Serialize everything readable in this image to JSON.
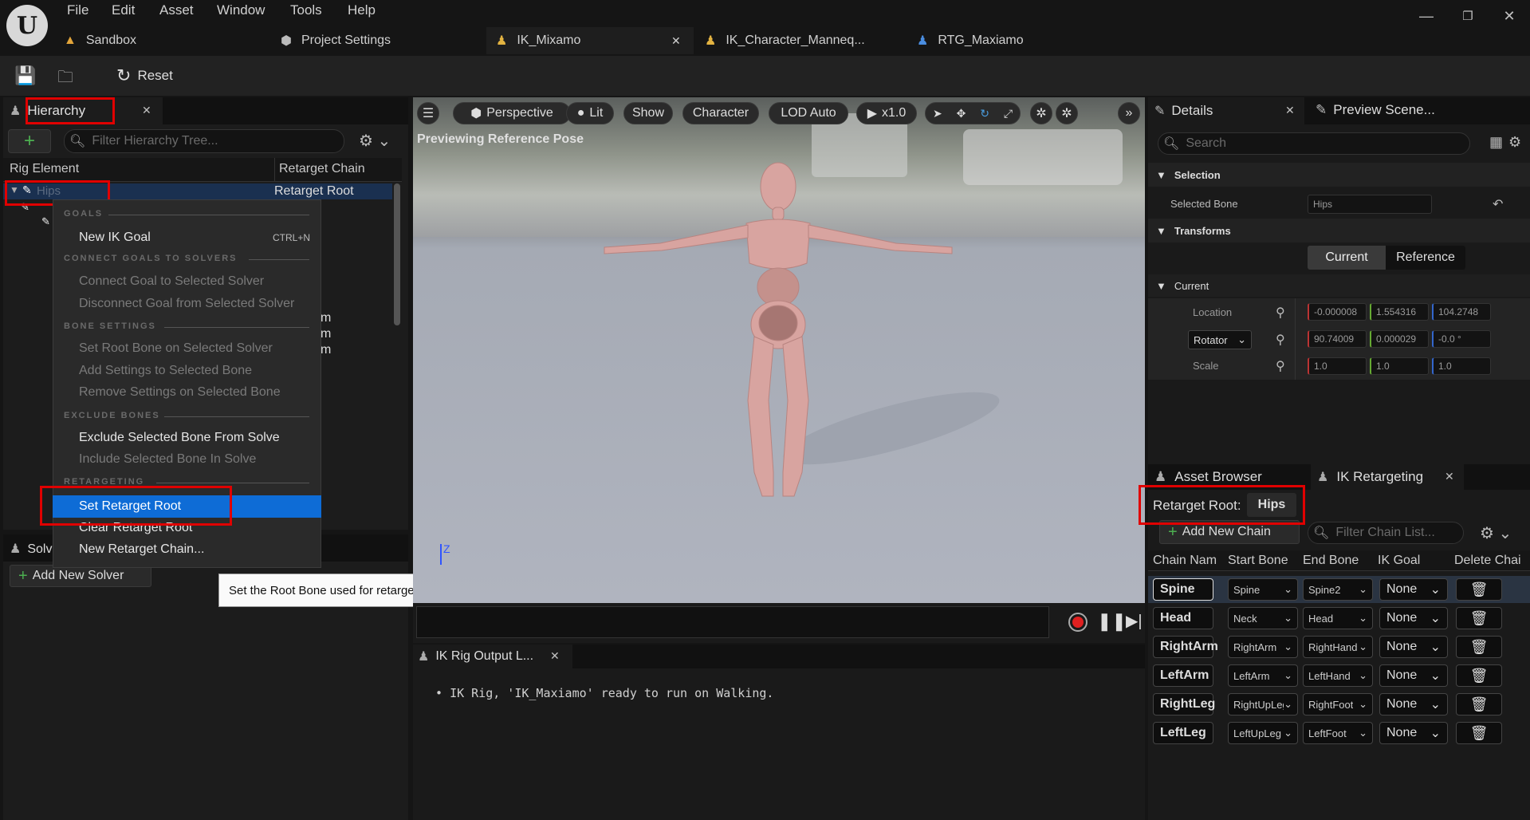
{
  "menu": [
    "File",
    "Edit",
    "Asset",
    "Window",
    "Tools",
    "Help"
  ],
  "tabs": [
    {
      "label": "Sandbox"
    },
    {
      "label": "Project Settings"
    },
    {
      "label": "IK_Mixamo"
    },
    {
      "label": "IK_Character_Manneq..."
    },
    {
      "label": "RTG_Maxiamo"
    }
  ],
  "toolbar": {
    "reset_label": "Reset"
  },
  "hierarchy": {
    "tab_label": "Hierarchy",
    "filter_placeholder": "Filter Hierarchy Tree...",
    "col_rig_element": "Rig Element",
    "col_retarget_chain": "Retarget Chain",
    "root_row_name": "Hips",
    "root_row_chain": "Retarget Root",
    "partial_m": "m"
  },
  "context_menu": {
    "sections": {
      "goals": "GOALS",
      "connect": "CONNECT GOALS TO SOLVERS",
      "bone": "BONE SETTINGS",
      "exclude": "EXCLUDE BONES",
      "retarget": "RETARGETING"
    },
    "new_ik_goal": "New IK Goal",
    "new_ik_goal_shortcut": "CTRL+N",
    "connect_goal": "Connect Goal to Selected Solver",
    "disconnect_goal": "Disconnect Goal from Selected Solver",
    "set_root_bone": "Set Root Bone on Selected Solver",
    "add_settings": "Add Settings to Selected Bone",
    "remove_settings": "Remove Settings on Selected Bone",
    "exclude_bone": "Exclude Selected Bone From Solve",
    "include_bone": "Include Selected Bone In Solve",
    "set_retarget_root": "Set Retarget Root",
    "clear_retarget_root": "Clear Retarget Root",
    "new_retarget_chain": "New Retarget Chain..."
  },
  "tooltip": "Set the Root Bone used for retargeting. Usually 'Pelvis'.",
  "solver": {
    "tab_partial": "Solv",
    "add_solver": "Add New Solver"
  },
  "viewport": {
    "perspective": "Perspective",
    "lit": "Lit",
    "show": "Show",
    "character": "Character",
    "lod": "LOD Auto",
    "speed": "x1.0",
    "previewing": "Previewing Reference Pose",
    "axis_z": "Z"
  },
  "output": {
    "tab_label": "IK Rig Output L...",
    "line": "IK Rig, 'IK_Maxiamo' ready to run on Walking."
  },
  "details": {
    "tab_label": "Details",
    "preview_tab": "Preview Scene...",
    "search_placeholder": "Search",
    "selection": "Selection",
    "selected_bone_label": "Selected Bone",
    "selected_bone_value": "Hips",
    "transforms": "Transforms",
    "btn_current": "Current",
    "btn_reference": "Reference",
    "current": "Current",
    "location_label": "Location",
    "location": [
      "-0.000008",
      "1.554316",
      "104.2748"
    ],
    "rotator_label": "Rotator",
    "rotator": [
      "90.74009",
      "0.000029",
      "-0.0 °"
    ],
    "scale_label": "Scale",
    "scale": [
      "1.0",
      "1.0",
      "1.0"
    ]
  },
  "retarget": {
    "asset_browser_tab": "Asset Browser",
    "ik_retargeting_tab": "IK Retargeting",
    "root_label": "Retarget Root:",
    "root_value": "Hips",
    "add_chain": "Add New Chain",
    "filter_placeholder": "Filter Chain List...",
    "headers": [
      "Chain Nam",
      "Start Bone",
      "End Bone",
      "IK Goal",
      "Delete Chai"
    ],
    "rows": [
      {
        "name": "Spine",
        "start": "Spine",
        "end": "Spine2",
        "goal": "None"
      },
      {
        "name": "Head",
        "start": "Neck",
        "end": "Head",
        "goal": "None"
      },
      {
        "name": "RightArm",
        "start": "RightArm",
        "end": "RightHand",
        "goal": "None"
      },
      {
        "name": "LeftArm",
        "start": "LeftArm",
        "end": "LeftHand",
        "goal": "None"
      },
      {
        "name": "RightLeg",
        "start": "RightUpLeg",
        "end": "RightFoot",
        "goal": "None"
      },
      {
        "name": "LeftLeg",
        "start": "LeftUpLeg",
        "end": "LeftFoot",
        "goal": "None"
      }
    ]
  },
  "colors": {
    "accent": "#0e6cd6",
    "highlight": "#e00000"
  }
}
